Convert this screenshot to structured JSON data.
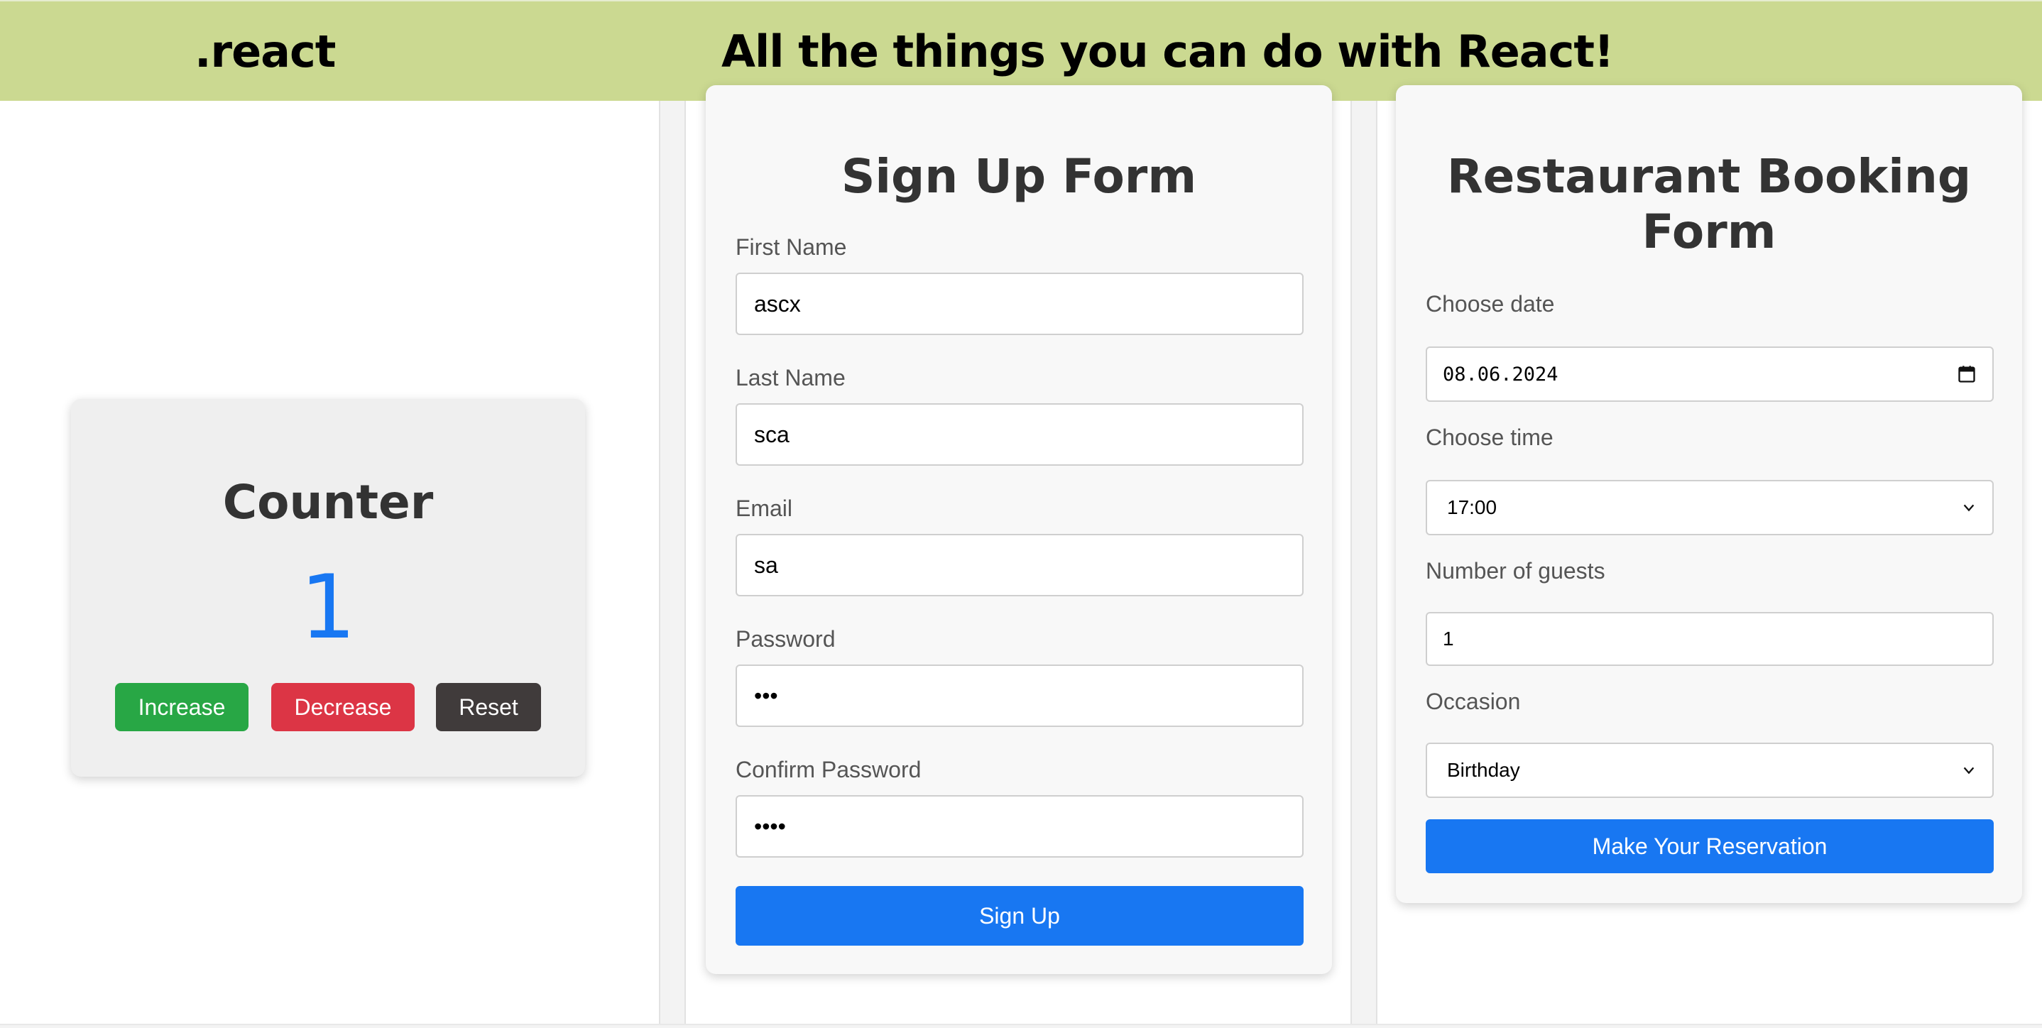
{
  "header": {
    "logo": ".react",
    "title": "All the things you can do with React!"
  },
  "counter": {
    "title": "Counter",
    "value": "1",
    "increase_label": "Increase",
    "decrease_label": "Decrease",
    "reset_label": "Reset"
  },
  "signup": {
    "title": "Sign Up Form",
    "first_name_label": "First Name",
    "first_name_value": "ascx",
    "last_name_label": "Last Name",
    "last_name_value": "sca",
    "email_label": "Email",
    "email_value": "sa",
    "password_label": "Password",
    "password_value": "abc",
    "confirm_label": "Confirm Password",
    "confirm_value": "abcd",
    "submit_label": "Sign Up"
  },
  "booking": {
    "title_line1": "Restaurant Booking",
    "title_line2": "Form",
    "date_label": "Choose date",
    "date_value": "08.06.2024",
    "time_label": "Choose time",
    "time_value": "17:00",
    "guests_label": "Number of guests",
    "guests_value": "1",
    "occasion_label": "Occasion",
    "occasion_value": "Birthday",
    "submit_label": "Make Your Reservation"
  },
  "colors": {
    "header_bg": "#cbd991",
    "accent_blue": "#1877f2",
    "increase_green": "#28a745",
    "decrease_red": "#dc3545",
    "reset_dark": "#403b3b"
  },
  "icons": {
    "date_picker": "calendar-icon",
    "select_arrow": "chevron-down-icon"
  }
}
